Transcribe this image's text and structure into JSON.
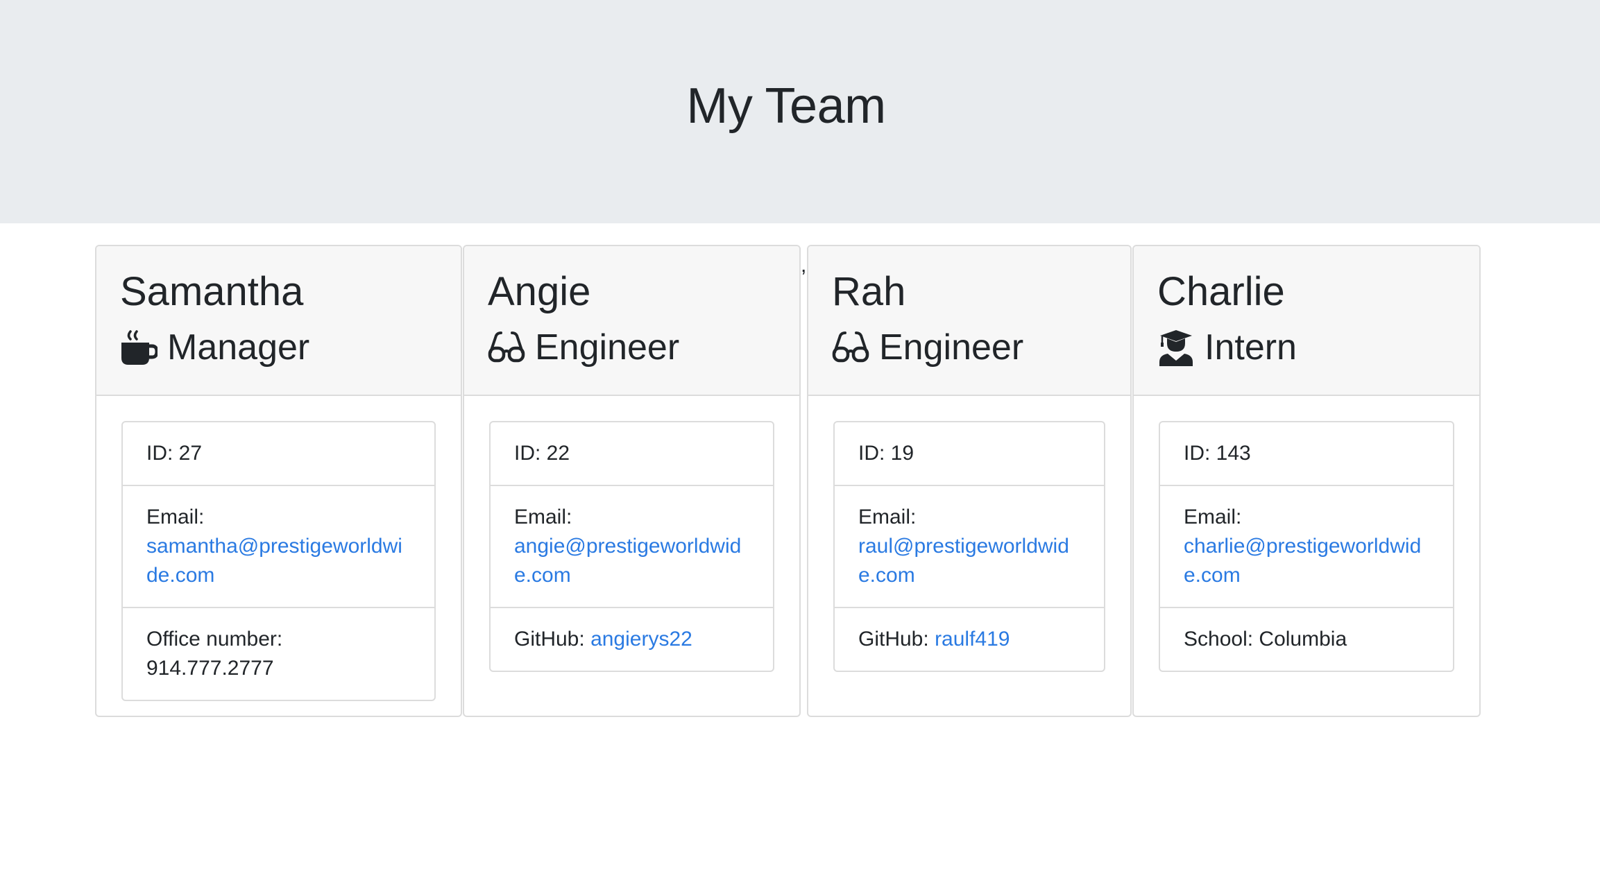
{
  "header": {
    "title": "My Team"
  },
  "stray_mark": ",",
  "cards": [
    {
      "name": "Samantha",
      "role": "Manager",
      "icon": "coffee-icon",
      "id_label": "ID: 27",
      "email_label": "Email:",
      "email": "samantha@prestigeworldwide.com",
      "extra_label": "Office number:",
      "extra_value": "914.777.2777"
    },
    {
      "name": "Angie",
      "role": "Engineer",
      "icon": "glasses-icon",
      "id_label": "ID: 22",
      "email_label": "Email:",
      "email": "angie@prestigeworldwide.com",
      "extra_label": "GitHub:",
      "extra_value": "angierys22"
    },
    {
      "name": "Rah",
      "role": "Engineer",
      "icon": "glasses-icon",
      "id_label": "ID: 19",
      "email_label": "Email:",
      "email": "raul@prestigeworldwide.com",
      "extra_label": "GitHub:",
      "extra_value": "raulf419"
    },
    {
      "name": "Charlie",
      "role": "Intern",
      "icon": "graduate-icon",
      "id_label": "ID: 143",
      "email_label": "Email:",
      "email": "charlie@prestigeworldwide.com",
      "extra_label": "School:",
      "extra_value": "Columbia"
    }
  ]
}
